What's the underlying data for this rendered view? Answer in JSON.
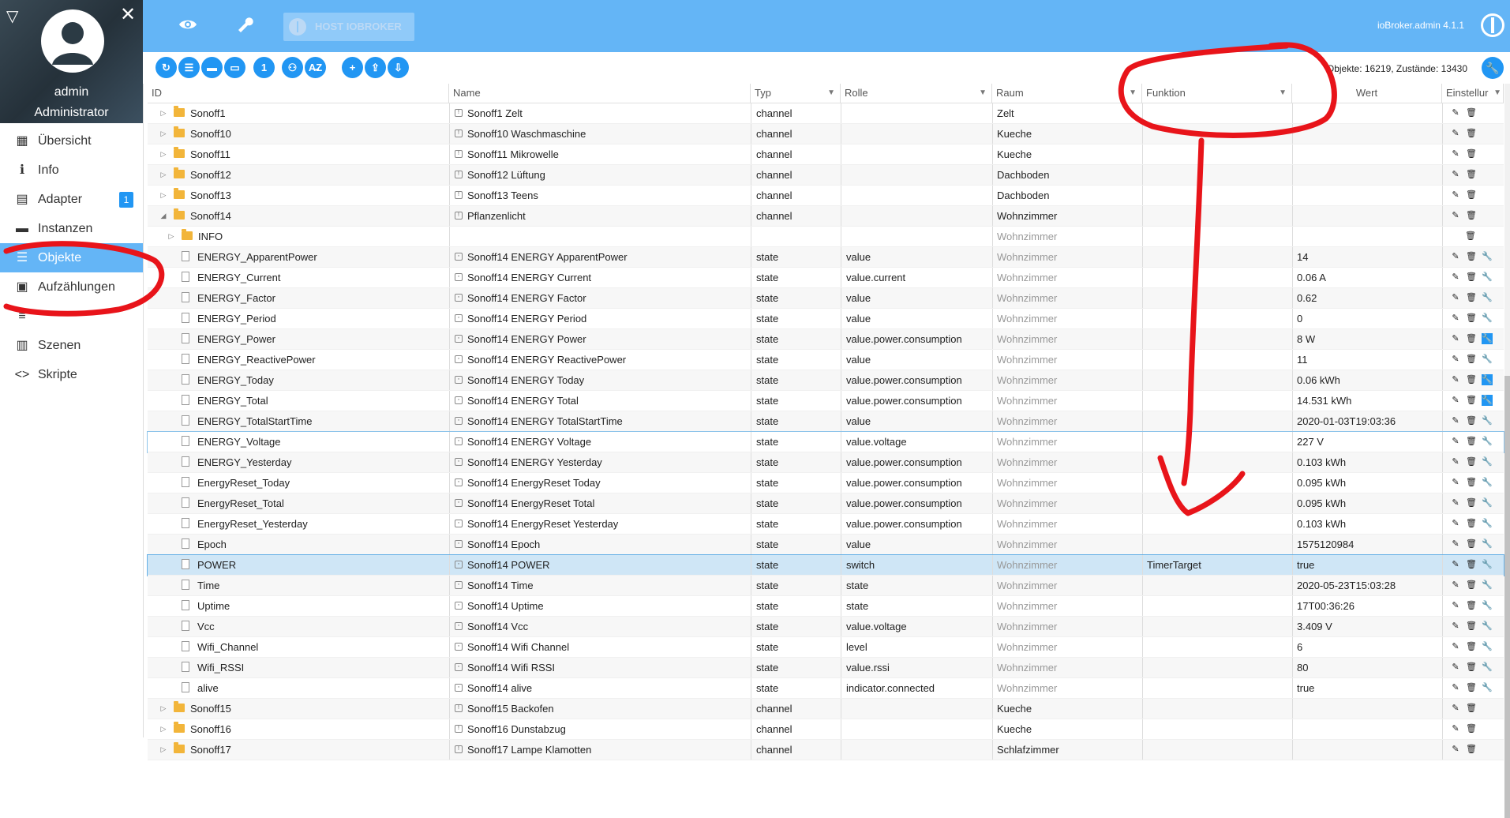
{
  "sidebar": {
    "user": "admin",
    "role": "Administrator",
    "items": [
      {
        "label": "Übersicht",
        "icon": "grid-icon",
        "glyph": "▦",
        "active": false
      },
      {
        "label": "Info",
        "icon": "info-icon",
        "glyph": "ℹ",
        "active": false
      },
      {
        "label": "Adapter",
        "icon": "store-icon",
        "glyph": "▤",
        "active": false,
        "badge": "1"
      },
      {
        "label": "Instanzen",
        "icon": "instances-icon",
        "glyph": "▬",
        "active": false
      },
      {
        "label": "Objekte",
        "icon": "list-icon",
        "glyph": "☰",
        "active": true
      },
      {
        "label": "Aufzählungen",
        "icon": "enum-icon",
        "glyph": "▣",
        "active": false
      },
      {
        "label": "",
        "icon": "log-icon",
        "glyph": "≡",
        "active": false
      },
      {
        "label": "Szenen",
        "icon": "scenes-icon",
        "glyph": "▥",
        "active": false
      },
      {
        "label": "Skripte",
        "icon": "code-icon",
        "glyph": "<>",
        "active": false
      }
    ]
  },
  "topbar": {
    "host_label": "HOST IOBROKER",
    "version": "ioBroker.admin 4.1.1"
  },
  "toolbar": {
    "counts": "Objekte: 16219, Zustände: 13430",
    "buttons": [
      "↻",
      "☰",
      "▬",
      "▭",
      "1",
      "⚇",
      "A̶Z",
      "+",
      "⇪",
      "⇩"
    ]
  },
  "columns": {
    "id": "ID",
    "name": "Name",
    "typ": "Typ",
    "rolle": "Rolle",
    "raum": "Raum",
    "funktion": "Funktion",
    "wert": "Wert",
    "einstellungen": "Einstellur"
  },
  "rows": [
    {
      "id": "Sonoff1",
      "indent": 0,
      "kind": "folder",
      "exp": "closed",
      "name": "Sonoff1 Zelt",
      "typ": "channel",
      "rolle": "",
      "raum": "Zelt",
      "raum_grey": false,
      "funk": "",
      "wert": "",
      "acts": [
        "edit",
        "delete"
      ]
    },
    {
      "id": "Sonoff10",
      "indent": 0,
      "kind": "folder",
      "exp": "closed",
      "name": "Sonoff10 Waschmaschine",
      "typ": "channel",
      "rolle": "",
      "raum": "Kueche",
      "raum_grey": false,
      "funk": "",
      "wert": "",
      "acts": [
        "edit",
        "delete"
      ]
    },
    {
      "id": "Sonoff11",
      "indent": 0,
      "kind": "folder",
      "exp": "closed",
      "name": "Sonoff11 Mikrowelle",
      "typ": "channel",
      "rolle": "",
      "raum": "Kueche",
      "raum_grey": false,
      "funk": "",
      "wert": "",
      "acts": [
        "edit",
        "delete"
      ]
    },
    {
      "id": "Sonoff12",
      "indent": 0,
      "kind": "folder",
      "exp": "closed",
      "name": "Sonoff12 Lüftung",
      "typ": "channel",
      "rolle": "",
      "raum": "Dachboden",
      "raum_grey": false,
      "funk": "",
      "wert": "",
      "acts": [
        "edit",
        "delete"
      ]
    },
    {
      "id": "Sonoff13",
      "indent": 0,
      "kind": "folder",
      "exp": "closed",
      "name": "Sonoff13 Teens",
      "typ": "channel",
      "rolle": "",
      "raum": "Dachboden",
      "raum_grey": false,
      "funk": "",
      "wert": "",
      "acts": [
        "edit",
        "delete"
      ]
    },
    {
      "id": "Sonoff14",
      "indent": 0,
      "kind": "folder",
      "exp": "open",
      "name": "Pflanzenlicht",
      "typ": "channel",
      "rolle": "",
      "raum": "Wohnzimmer",
      "raum_grey": false,
      "funk": "",
      "wert": "",
      "acts": [
        "edit",
        "delete"
      ]
    },
    {
      "id": "INFO",
      "indent": 1,
      "kind": "folder",
      "exp": "closed",
      "name": "",
      "typ": "",
      "rolle": "",
      "raum": "Wohnzimmer",
      "raum_grey": true,
      "funk": "",
      "wert": "",
      "acts": [
        "delete"
      ]
    },
    {
      "id": "ENERGY_ApparentPower",
      "indent": 1,
      "kind": "file",
      "name": "Sonoff14 ENERGY ApparentPower",
      "typ": "state",
      "rolle": "value",
      "raum": "Wohnzimmer",
      "raum_grey": true,
      "funk": "",
      "wert": "14",
      "acts": [
        "edit",
        "delete",
        "wrench"
      ]
    },
    {
      "id": "ENERGY_Current",
      "indent": 1,
      "kind": "file",
      "name": "Sonoff14 ENERGY Current",
      "typ": "state",
      "rolle": "value.current",
      "raum": "Wohnzimmer",
      "raum_grey": true,
      "funk": "",
      "wert": "0.06 A",
      "acts": [
        "edit",
        "delete",
        "wrench"
      ]
    },
    {
      "id": "ENERGY_Factor",
      "indent": 1,
      "kind": "file",
      "name": "Sonoff14 ENERGY Factor",
      "typ": "state",
      "rolle": "value",
      "raum": "Wohnzimmer",
      "raum_grey": true,
      "funk": "",
      "wert": "0.62",
      "acts": [
        "edit",
        "delete",
        "wrench"
      ]
    },
    {
      "id": "ENERGY_Period",
      "indent": 1,
      "kind": "file",
      "name": "Sonoff14 ENERGY Period",
      "typ": "state",
      "rolle": "value",
      "raum": "Wohnzimmer",
      "raum_grey": true,
      "funk": "",
      "wert": "0",
      "acts": [
        "edit",
        "delete",
        "wrench"
      ]
    },
    {
      "id": "ENERGY_Power",
      "indent": 1,
      "kind": "file",
      "name": "Sonoff14 ENERGY Power",
      "typ": "state",
      "rolle": "value.power.consumption",
      "raum": "Wohnzimmer",
      "raum_grey": true,
      "funk": "",
      "wert": "8 W",
      "acts": [
        "edit",
        "delete",
        "wrench-blue"
      ]
    },
    {
      "id": "ENERGY_ReactivePower",
      "indent": 1,
      "kind": "file",
      "name": "Sonoff14 ENERGY ReactivePower",
      "typ": "state",
      "rolle": "value",
      "raum": "Wohnzimmer",
      "raum_grey": true,
      "funk": "",
      "wert": "11",
      "acts": [
        "edit",
        "delete",
        "wrench"
      ]
    },
    {
      "id": "ENERGY_Today",
      "indent": 1,
      "kind": "file",
      "name": "Sonoff14 ENERGY Today",
      "typ": "state",
      "rolle": "value.power.consumption",
      "raum": "Wohnzimmer",
      "raum_grey": true,
      "funk": "",
      "wert": "0.06 kWh",
      "acts": [
        "edit",
        "delete",
        "wrench-blue"
      ]
    },
    {
      "id": "ENERGY_Total",
      "indent": 1,
      "kind": "file",
      "name": "Sonoff14 ENERGY Total",
      "typ": "state",
      "rolle": "value.power.consumption",
      "raum": "Wohnzimmer",
      "raum_grey": true,
      "funk": "",
      "wert": "14.531 kWh",
      "acts": [
        "edit",
        "delete",
        "wrench-blue"
      ]
    },
    {
      "id": "ENERGY_TotalStartTime",
      "indent": 1,
      "kind": "file",
      "name": "Sonoff14 ENERGY TotalStartTime",
      "typ": "state",
      "rolle": "value",
      "raum": "Wohnzimmer",
      "raum_grey": true,
      "funk": "",
      "wert": "2020-01-03T19:03:36",
      "acts": [
        "edit",
        "delete",
        "wrench"
      ]
    },
    {
      "id": "ENERGY_Voltage",
      "indent": 1,
      "kind": "file",
      "name": "Sonoff14 ENERGY Voltage",
      "typ": "state",
      "rolle": "value.voltage",
      "raum": "Wohnzimmer",
      "raum_grey": true,
      "funk": "",
      "wert": "227 V",
      "acts": [
        "edit",
        "delete",
        "wrench"
      ],
      "hl": true
    },
    {
      "id": "ENERGY_Yesterday",
      "indent": 1,
      "kind": "file",
      "name": "Sonoff14 ENERGY Yesterday",
      "typ": "state",
      "rolle": "value.power.consumption",
      "raum": "Wohnzimmer",
      "raum_grey": true,
      "funk": "",
      "wert": "0.103 kWh",
      "acts": [
        "edit",
        "delete",
        "wrench"
      ]
    },
    {
      "id": "EnergyReset_Today",
      "indent": 1,
      "kind": "file",
      "name": "Sonoff14 EnergyReset Today",
      "typ": "state",
      "rolle": "value.power.consumption",
      "raum": "Wohnzimmer",
      "raum_grey": true,
      "funk": "",
      "wert": "0.095 kWh",
      "acts": [
        "edit",
        "delete",
        "wrench"
      ]
    },
    {
      "id": "EnergyReset_Total",
      "indent": 1,
      "kind": "file",
      "name": "Sonoff14 EnergyReset Total",
      "typ": "state",
      "rolle": "value.power.consumption",
      "raum": "Wohnzimmer",
      "raum_grey": true,
      "funk": "",
      "wert": "0.095 kWh",
      "acts": [
        "edit",
        "delete",
        "wrench"
      ]
    },
    {
      "id": "EnergyReset_Yesterday",
      "indent": 1,
      "kind": "file",
      "name": "Sonoff14 EnergyReset Yesterday",
      "typ": "state",
      "rolle": "value.power.consumption",
      "raum": "Wohnzimmer",
      "raum_grey": true,
      "funk": "",
      "wert": "0.103 kWh",
      "acts": [
        "edit",
        "delete",
        "wrench"
      ]
    },
    {
      "id": "Epoch",
      "indent": 1,
      "kind": "file",
      "name": "Sonoff14 Epoch",
      "typ": "state",
      "rolle": "value",
      "raum": "Wohnzimmer",
      "raum_grey": true,
      "funk": "",
      "wert": "1575120984",
      "acts": [
        "edit",
        "delete",
        "wrench"
      ]
    },
    {
      "id": "POWER",
      "indent": 1,
      "kind": "file",
      "name": "Sonoff14 POWER",
      "typ": "state",
      "rolle": "switch",
      "raum": "Wohnzimmer",
      "raum_grey": true,
      "funk": "TimerTarget",
      "wert": "true",
      "acts": [
        "edit",
        "delete",
        "wrench"
      ],
      "sel": true
    },
    {
      "id": "Time",
      "indent": 1,
      "kind": "file",
      "name": "Sonoff14 Time",
      "typ": "state",
      "rolle": "state",
      "raum": "Wohnzimmer",
      "raum_grey": true,
      "funk": "",
      "wert": "2020-05-23T15:03:28",
      "acts": [
        "edit",
        "delete",
        "wrench"
      ]
    },
    {
      "id": "Uptime",
      "indent": 1,
      "kind": "file",
      "name": "Sonoff14 Uptime",
      "typ": "state",
      "rolle": "state",
      "raum": "Wohnzimmer",
      "raum_grey": true,
      "funk": "",
      "wert": "17T00:36:26",
      "acts": [
        "edit",
        "delete",
        "wrench"
      ]
    },
    {
      "id": "Vcc",
      "indent": 1,
      "kind": "file",
      "name": "Sonoff14 Vcc",
      "typ": "state",
      "rolle": "value.voltage",
      "raum": "Wohnzimmer",
      "raum_grey": true,
      "funk": "",
      "wert": "3.409 V",
      "acts": [
        "edit",
        "delete",
        "wrench"
      ]
    },
    {
      "id": "Wifi_Channel",
      "indent": 1,
      "kind": "file",
      "name": "Sonoff14 Wifi Channel",
      "typ": "state",
      "rolle": "level",
      "raum": "Wohnzimmer",
      "raum_grey": true,
      "funk": "",
      "wert": "6",
      "acts": [
        "edit",
        "delete",
        "wrench"
      ]
    },
    {
      "id": "Wifi_RSSI",
      "indent": 1,
      "kind": "file",
      "name": "Sonoff14 Wifi RSSI",
      "typ": "state",
      "rolle": "value.rssi",
      "raum": "Wohnzimmer",
      "raum_grey": true,
      "funk": "",
      "wert": "80",
      "acts": [
        "edit",
        "delete",
        "wrench"
      ]
    },
    {
      "id": "alive",
      "indent": 1,
      "kind": "file",
      "name": "Sonoff14 alive",
      "typ": "state",
      "rolle": "indicator.connected",
      "raum": "Wohnzimmer",
      "raum_grey": true,
      "funk": "",
      "wert": "true",
      "acts": [
        "edit",
        "delete",
        "wrench"
      ]
    },
    {
      "id": "Sonoff15",
      "indent": 0,
      "kind": "folder",
      "exp": "closed",
      "name": "Sonoff15 Backofen",
      "typ": "channel",
      "rolle": "",
      "raum": "Kueche",
      "raum_grey": false,
      "funk": "",
      "wert": "",
      "acts": [
        "edit",
        "delete"
      ]
    },
    {
      "id": "Sonoff16",
      "indent": 0,
      "kind": "folder",
      "exp": "closed",
      "name": "Sonoff16 Dunstabzug",
      "typ": "channel",
      "rolle": "",
      "raum": "Kueche",
      "raum_grey": false,
      "funk": "",
      "wert": "",
      "acts": [
        "edit",
        "delete"
      ]
    },
    {
      "id": "Sonoff17",
      "indent": 0,
      "kind": "folder",
      "exp": "closed",
      "name": "Sonoff17 Lampe Klamotten",
      "typ": "channel",
      "rolle": "",
      "raum": "Schlafzimmer",
      "raum_grey": false,
      "funk": "",
      "wert": "",
      "acts": [
        "edit",
        "delete"
      ]
    }
  ]
}
